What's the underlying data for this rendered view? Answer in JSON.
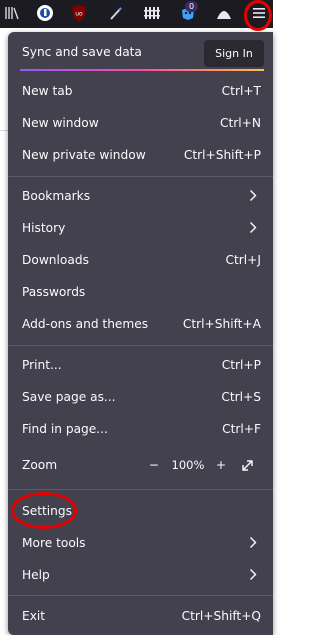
{
  "toolbar": {
    "icons": [
      "library-icon",
      "account-icon",
      "ublock-origin-icon",
      "pen-icon",
      "fence-icon",
      "mask-extension-icon",
      "arc-icon",
      "hamburger-menu-icon"
    ],
    "badge_count": "0"
  },
  "menu": {
    "sync_label": "Sync and save data",
    "sign_in_label": "Sign In",
    "items": {
      "new_tab": {
        "label": "New tab",
        "shortcut": "Ctrl+T"
      },
      "new_window": {
        "label": "New window",
        "shortcut": "Ctrl+N"
      },
      "new_private_window": {
        "label": "New private window",
        "shortcut": "Ctrl+Shift+P"
      },
      "bookmarks": {
        "label": "Bookmarks"
      },
      "history": {
        "label": "History"
      },
      "downloads": {
        "label": "Downloads",
        "shortcut": "Ctrl+J"
      },
      "passwords": {
        "label": "Passwords"
      },
      "addons": {
        "label": "Add-ons and themes",
        "shortcut": "Ctrl+Shift+A"
      },
      "print": {
        "label": "Print...",
        "shortcut": "Ctrl+P"
      },
      "save_page": {
        "label": "Save page as...",
        "shortcut": "Ctrl+S"
      },
      "find": {
        "label": "Find in page...",
        "shortcut": "Ctrl+F"
      },
      "zoom": {
        "label": "Zoom",
        "minus": "−",
        "value": "100%",
        "plus": "+"
      },
      "settings": {
        "label": "Settings"
      },
      "more_tools": {
        "label": "More tools"
      },
      "help": {
        "label": "Help"
      },
      "exit": {
        "label": "Exit",
        "shortcut": "Ctrl+Shift+Q"
      }
    }
  },
  "colors": {
    "panel_bg": "#42414d",
    "toolbar_bg": "#1c1b22",
    "annotation": "#e60000",
    "separator": "#5b5a66"
  }
}
